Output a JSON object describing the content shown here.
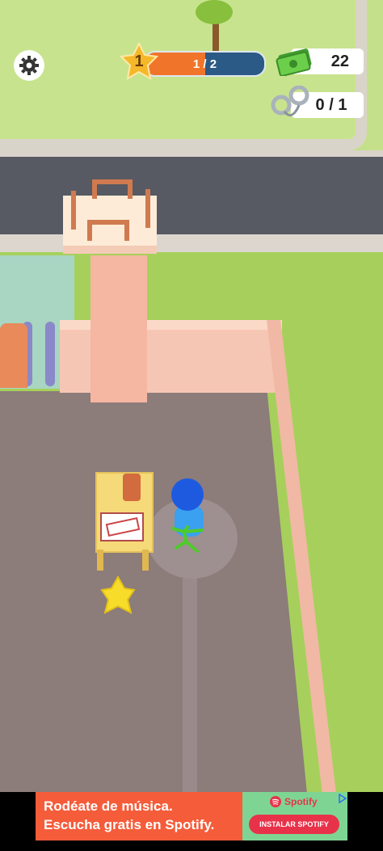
{
  "hud": {
    "level": "1",
    "xp_text": "1 / 2",
    "xp_progress": 0.5,
    "money": "22",
    "prisoners": "0 / 1"
  },
  "icons": {
    "settings": "gear-icon",
    "level": "star-icon",
    "money": "cash-icon",
    "prisoners": "handcuffs-icon"
  },
  "ad": {
    "line1": "Rodéate de música.",
    "line2": "Escucha gratis en Spotify.",
    "brand": "Spotify",
    "cta": "INSTALAR SPOTIFY"
  },
  "colors": {
    "xp_fill": "#f0752a",
    "xp_track": "#2b5a86",
    "ad_bg": "#f55c3a",
    "ad_cta": "#e8324a"
  }
}
